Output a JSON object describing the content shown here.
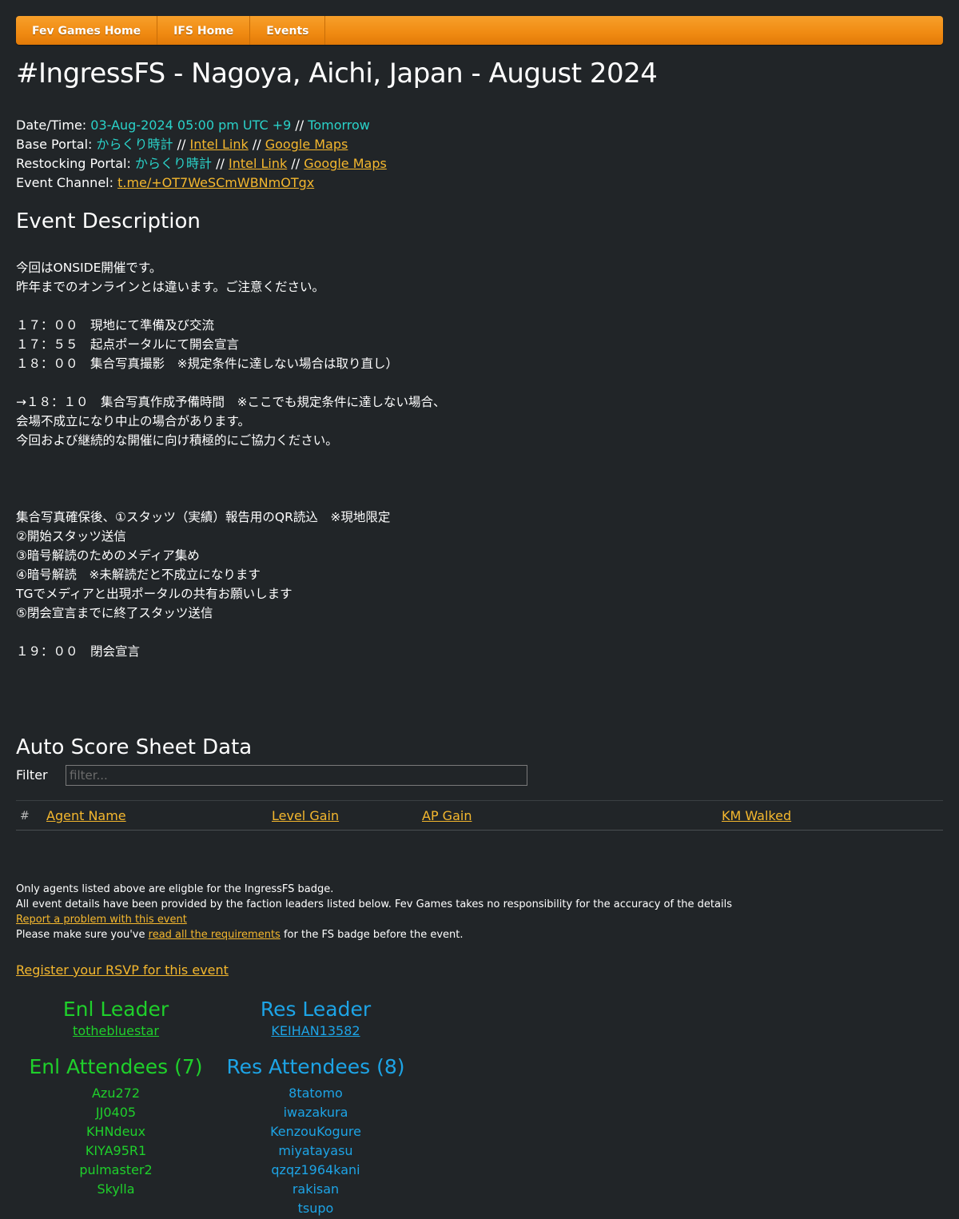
{
  "nav": {
    "items": [
      "Fev Games Home",
      "IFS Home",
      "Events"
    ]
  },
  "page_title": "#IngressFS - Nagoya, Aichi, Japan - August 2024",
  "info": {
    "datetime_label": "Date/Time:",
    "datetime_value": "03-Aug-2024 05:00 pm UTC +9",
    "sep": "//",
    "datetime_relative": "Tomorrow",
    "base_label": "Base Portal:",
    "base_portal": "からくり時計",
    "restock_label": "Restocking Portal:",
    "restock_portal": "からくり時計",
    "intel_link": "Intel Link",
    "maps_link": "Google Maps",
    "channel_label": "Event Channel:",
    "channel_link": "t.me/+OT7WeSCmWBNmOTgx"
  },
  "description": {
    "title": "Event Description",
    "text": "今回はONSIDE開催です。\n昨年までのオンラインとは違います。ご注意ください。\n\n１７：００　現地にて準備及び交流\n１７：５５　起点ポータルにて開会宣言\n１８：００　集合写真撮影　※規定条件に達しない場合は取り直し）\n\n→１８：１０　集合写真作成予備時間　※ここでも規定条件に達しない場合、\n会場不成立になり中止の場合があります。\n今回および継続的な開催に向け積極的にご協力ください。\n\n\n\n集合写真確保後、①スタッツ（実績）報告用のQR読込　※現地限定\n②開始スタッツ送信\n③暗号解読のためのメディア集め\n④暗号解読　※未解読だと不成立になります\nTGでメディアと出現ポータルの共有お願いします\n⑤閉会宣言までに終了スタッツ送信\n\n１９：００　閉会宣言"
  },
  "score": {
    "title": "Auto Score Sheet Data",
    "filter_label": "Filter",
    "filter_placeholder": "filter...",
    "columns": [
      "#",
      "Agent Name",
      "Level Gain",
      "AP Gain",
      "KM Walked"
    ]
  },
  "notes": {
    "line1": "Only agents listed above are eligble for the IngressFS badge.",
    "line2": "All event details have been provided by the faction leaders listed below. Fev Games takes no responsibility for the accuracy of the details",
    "report_link": "Report a problem with this event",
    "line4_pre": "Please make sure you've",
    "requirements_link": "read all the requirements",
    "line4_post": "for the FS badge before the event."
  },
  "rsvp_link": "Register your RSVP for this event",
  "enl": {
    "leader_title": "Enl Leader",
    "leader": "tothebluestar",
    "attendees_title": "Enl Attendees (7)",
    "attendees": [
      "Azu272",
      "JJ0405",
      "KHNdeux",
      "KIYA95R1",
      "pulmaster2",
      "Skylla"
    ]
  },
  "res": {
    "leader_title": "Res Leader",
    "leader": "KEIHAN13582",
    "attendees_title": "Res Attendees (8)",
    "attendees": [
      "8tatomo",
      "iwazakura",
      "KenzouKogure",
      "miyatayasu",
      "qzqz1964kani",
      "rakisan",
      "tsupo"
    ]
  },
  "colors": {
    "background": "#212528",
    "nav_orange": "#f08a12",
    "link": "#f5b82e",
    "cyan": "#2ad2c9",
    "enl_green": "#1fd02b",
    "res_blue": "#1da4e6"
  }
}
